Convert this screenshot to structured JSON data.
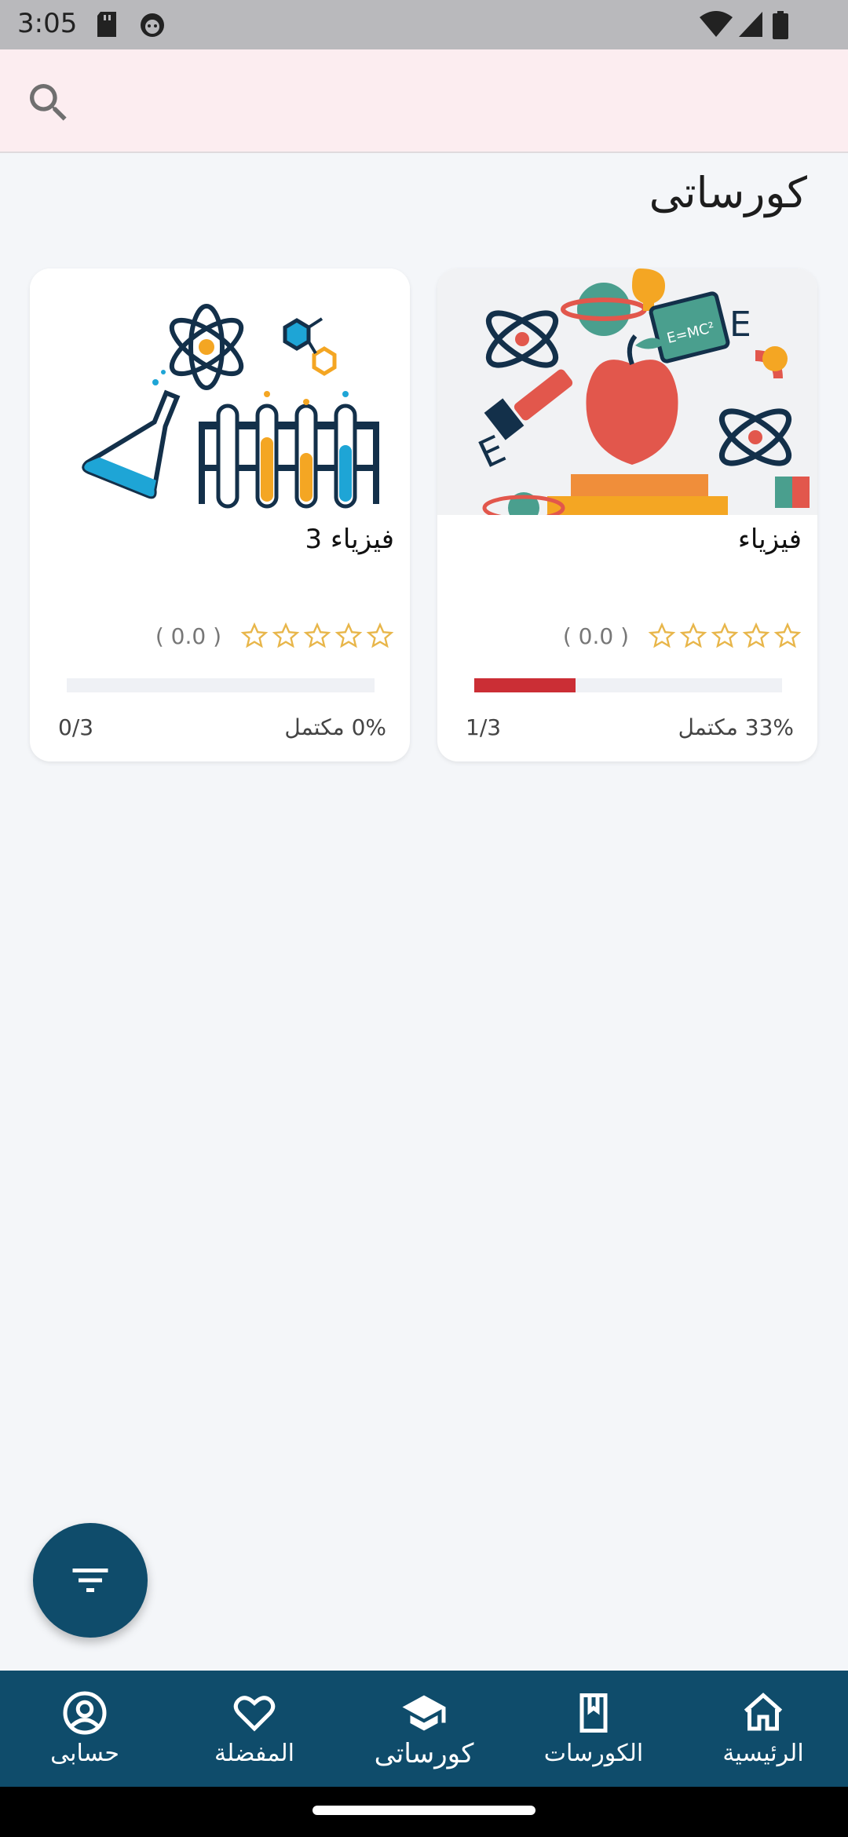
{
  "status_bar": {
    "time": "3:05"
  },
  "search": {
    "icon": "search-icon"
  },
  "page": {
    "title": "كورساتى"
  },
  "courses": [
    {
      "title": "فيزياء",
      "rating_text": "( 0.0 )",
      "rating": 0,
      "progress": 0.33,
      "completed_text": "33% مكتمل",
      "count_text": "1/3",
      "thumbnail": "science-collage-illustration"
    },
    {
      "title": "فيزياء 3",
      "rating_text": "( 0.0 )",
      "rating": 0,
      "progress": 0.0,
      "completed_text": "0% مكتمل",
      "count_text": "0/3",
      "thumbnail": "chemistry-lab-illustration"
    }
  ],
  "fab": {
    "icon": "filter-icon"
  },
  "nav": {
    "items": [
      {
        "label": "الرئيسية",
        "icon": "home-icon"
      },
      {
        "label": "الكورسات",
        "icon": "book-icon"
      },
      {
        "label": "كورساتى",
        "icon": "graduation-cap-icon",
        "active": true
      },
      {
        "label": "المفضلة",
        "icon": "heart-icon"
      },
      {
        "label": "حسابى",
        "icon": "account-icon"
      }
    ]
  },
  "colors": {
    "primary": "#0f4c6b",
    "progress": "#cb2e35",
    "star": "#e8b64a",
    "header_bg": "#fcedf0"
  }
}
